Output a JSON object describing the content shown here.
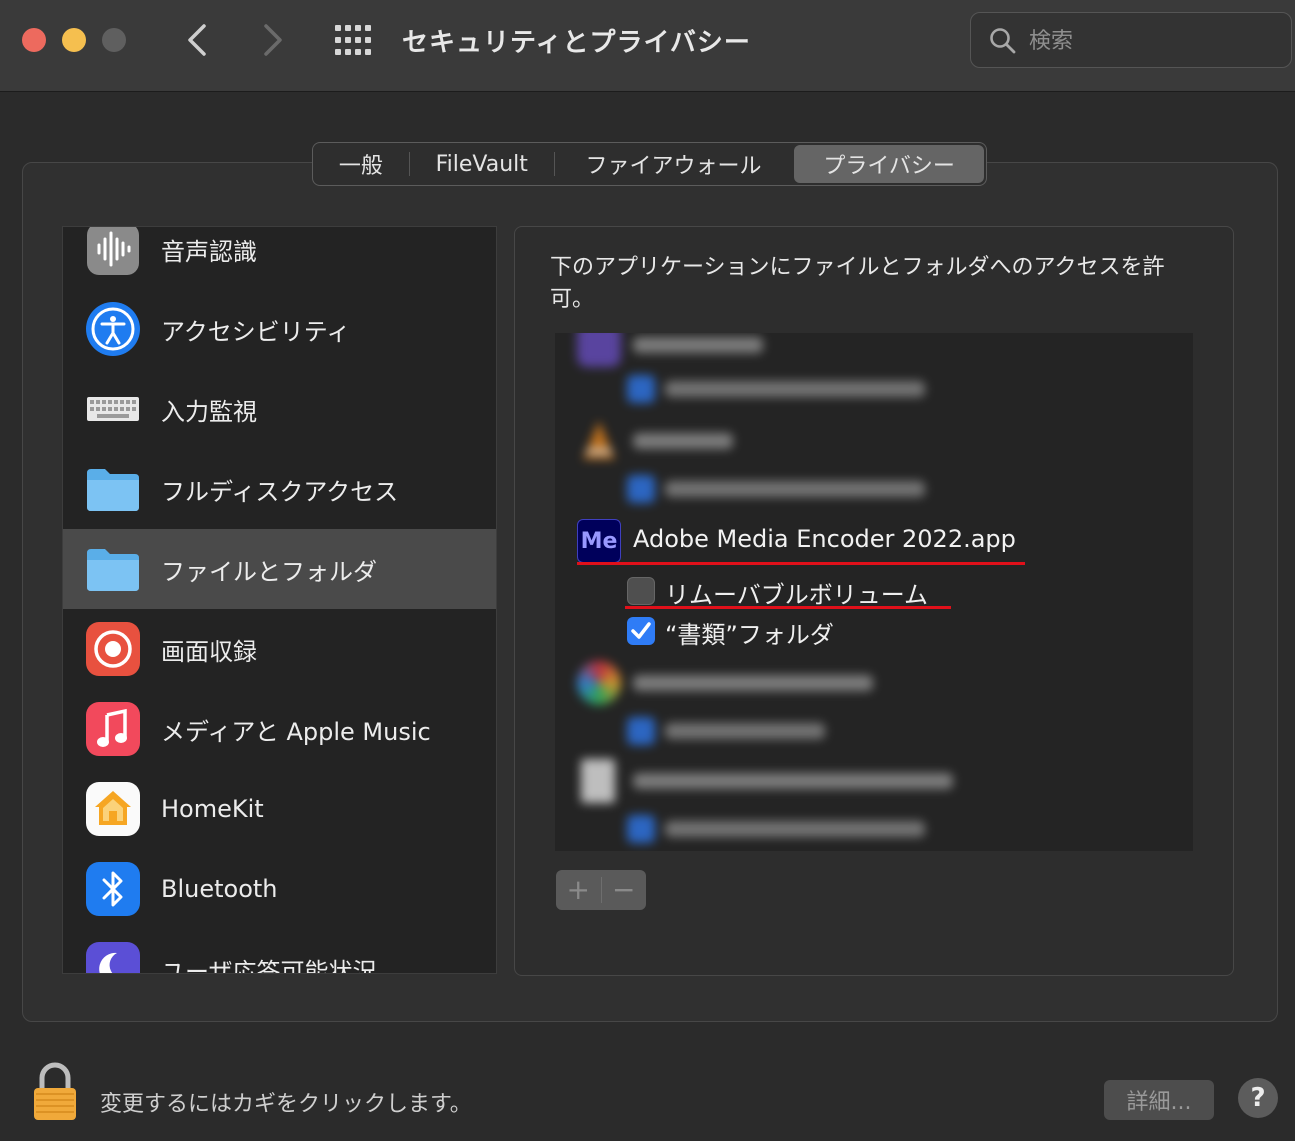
{
  "window": {
    "title": "セキュリティとプライバシー",
    "search_placeholder": "検索"
  },
  "tabs": [
    {
      "label": "一般",
      "active": false
    },
    {
      "label": "FileVault",
      "active": false
    },
    {
      "label": "ファイアウォール",
      "active": false
    },
    {
      "label": "プライバシー",
      "active": true
    }
  ],
  "sidebar": {
    "items": [
      {
        "label": "音声認識",
        "icon": "waveform-icon"
      },
      {
        "label": "アクセシビリティ",
        "icon": "accessibility-icon"
      },
      {
        "label": "入力監視",
        "icon": "keyboard-icon"
      },
      {
        "label": "フルディスクアクセス",
        "icon": "folder-icon"
      },
      {
        "label": "ファイルとフォルダ",
        "icon": "folder-icon",
        "selected": true
      },
      {
        "label": "画面収録",
        "icon": "screen-record-icon"
      },
      {
        "label": "メディアと Apple Music",
        "icon": "music-icon"
      },
      {
        "label": "HomeKit",
        "icon": "home-icon"
      },
      {
        "label": "Bluetooth",
        "icon": "bluetooth-icon"
      },
      {
        "label": "ユーザ応答可能状況",
        "icon": "moon-icon"
      }
    ]
  },
  "main": {
    "description": "下のアプリケーションにファイルとフォルダへのアクセスを許可。",
    "focused_app": {
      "name": "Adobe Media Encoder 2022.app",
      "icon_text": "Me",
      "permissions": [
        {
          "label": "リムーバブルボリューム",
          "checked": false
        },
        {
          "label": "“書類”フォルダ",
          "checked": true
        }
      ]
    }
  },
  "footer": {
    "lock_message": "変更するにはカギをクリックします。",
    "details_label": "詳細...",
    "help_label": "?"
  },
  "colors": {
    "accent": "#2f7cf6",
    "annotation_underline": "#e0101a",
    "selected_row": "#4a4a4a"
  }
}
